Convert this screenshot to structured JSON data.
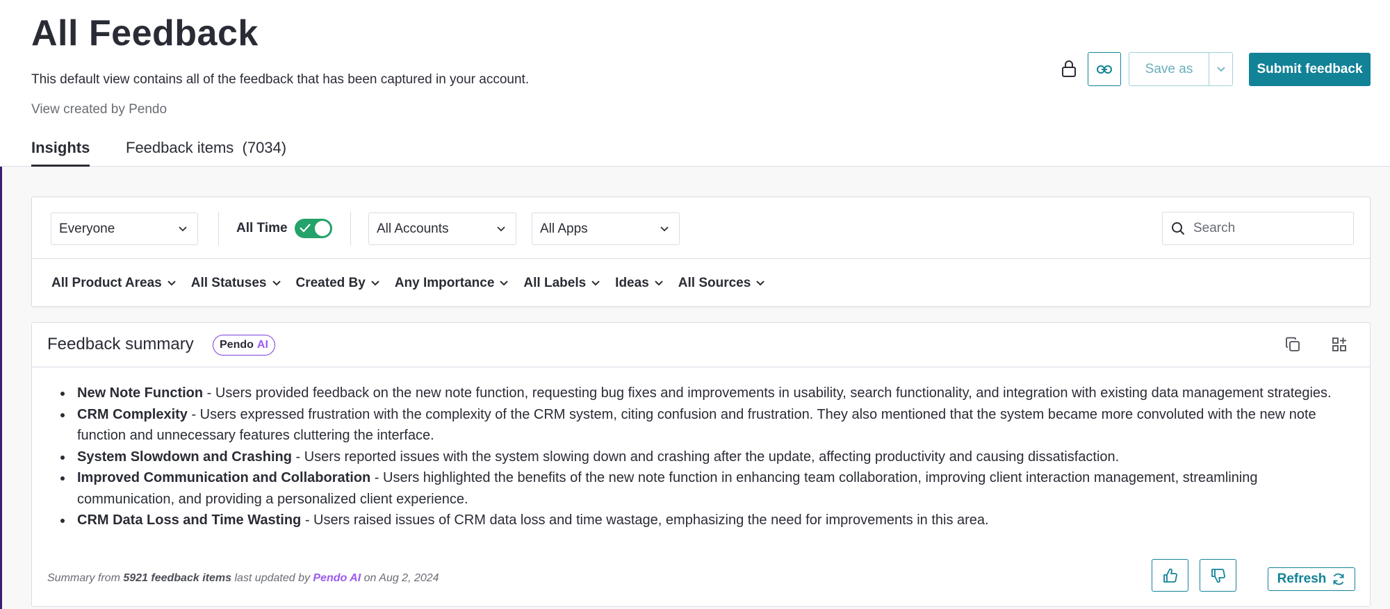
{
  "header": {
    "title": "All Feedback",
    "description": "This default view contains all of the feedback that has been captured in your account.",
    "created_by": "View created by Pendo",
    "save_as_label": "Save as",
    "submit_label": "Submit feedback"
  },
  "tabs": [
    {
      "label": "Insights",
      "active": true
    },
    {
      "label": "Feedback items  (7034)",
      "active": false
    }
  ],
  "filters": {
    "audience": "Everyone",
    "all_time_label": "All Time",
    "all_time_on": true,
    "accounts": "All Accounts",
    "apps": "All Apps",
    "search_placeholder": "Search",
    "dropdowns": [
      "All Product Areas",
      "All Statuses",
      "Created By",
      "Any Importance",
      "All Labels",
      "Ideas",
      "All Sources"
    ]
  },
  "summary": {
    "title": "Feedback summary",
    "badge_brand": "Pendo",
    "badge_ai": "AI",
    "items": [
      {
        "title": "New Note Function",
        "text": " - Users provided feedback on the new note function, requesting bug fixes and improvements in usability, search functionality, and integration with existing data management strategies."
      },
      {
        "title": "CRM Complexity",
        "text": " - Users expressed frustration with the complexity of the CRM system, citing confusion and frustration. They also mentioned that the system became more convoluted with the new note function and unnecessary features cluttering the interface."
      },
      {
        "title": "System Slowdown and Crashing",
        "text": " - Users reported issues with the system slowing down and crashing after the update, affecting productivity and causing dissatisfaction."
      },
      {
        "title": "Improved Communication and Collaboration",
        "text": " - Users highlighted the benefits of the new note function in enhancing team collaboration, improving client interaction management, streamlining communication, and providing a personalized client experience."
      },
      {
        "title": "CRM Data Loss and Time Wasting",
        "text": " - Users raised issues of CRM data loss and time wastage, emphasizing the need for improvements in this area."
      }
    ],
    "footer": {
      "prefix": "Summary from ",
      "count": "5921 feedback items",
      "middle": " last updated by ",
      "author": "Pendo AI",
      "date": " on Aug 2, 2024"
    },
    "refresh_label": "Refresh"
  },
  "colors": {
    "accent": "#128297",
    "toggle_on": "#23a26a",
    "ai_purple": "#9a5cf0",
    "left_bar": "#3a1d6e"
  }
}
